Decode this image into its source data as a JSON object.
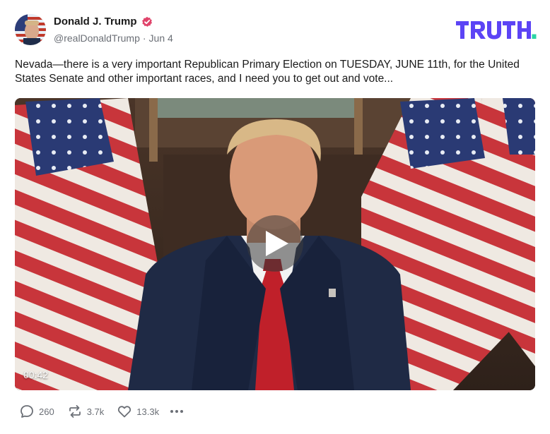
{
  "author": {
    "display_name": "Donald J. Trump",
    "handle": "@realDonaldTrump",
    "separator": "·",
    "date": "Jun 4",
    "verified_color": "#e0446b"
  },
  "brand": {
    "logo_text": "TRUTH.",
    "color": "#5c44f5",
    "dot_color": "#2bd4a4"
  },
  "post": {
    "text": "Nevada—there is a very important Republican Primary Election on TUESDAY, JUNE 11th, for the United States Senate and other important races, and I need you to get out and vote..."
  },
  "video": {
    "duration": "00:42"
  },
  "actions": {
    "replies": "260",
    "retruths": "3.7k",
    "likes": "13.3k"
  },
  "icons": [
    "avatar",
    "verified-icon",
    "truth-logo",
    "play-icon",
    "reply-icon",
    "retruth-icon",
    "like-icon",
    "more-icon"
  ]
}
